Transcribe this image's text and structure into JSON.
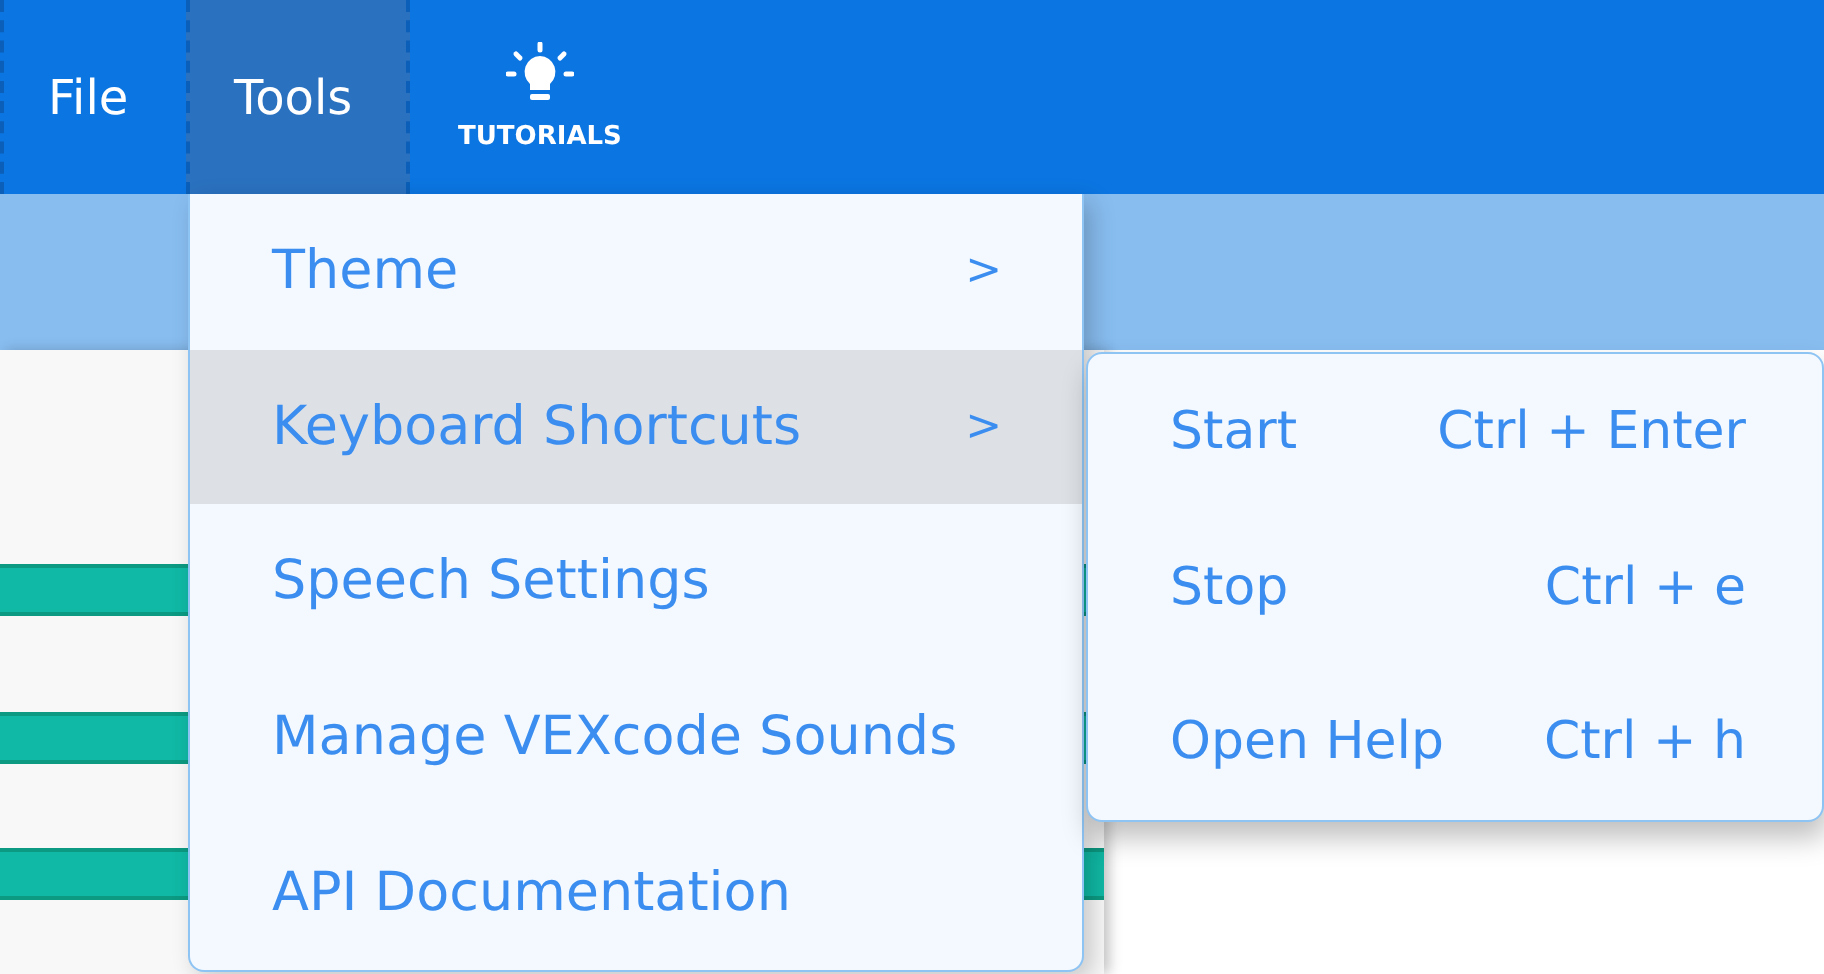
{
  "menubar": [
    {
      "kind": "text",
      "label": "File",
      "selected": false
    },
    {
      "kind": "text",
      "label": "Tools",
      "selected": true
    },
    {
      "kind": "icon",
      "label": "TUTORIALS",
      "selected": false
    }
  ],
  "tools_menu": {
    "items": [
      {
        "label": "Theme",
        "arrow": ">",
        "selected": false
      },
      {
        "label": "Keyboard Shortcuts",
        "arrow": ">",
        "selected": true
      },
      {
        "label": "Speech Settings",
        "selected": false
      },
      {
        "label": "Manage VEXcode Sounds",
        "selected": false
      },
      {
        "label": "API Documentation",
        "selected": false
      }
    ]
  },
  "shortcuts_menu": {
    "items": [
      {
        "label": "Start",
        "shortcut": "Ctrl + Enter"
      },
      {
        "label": "Stop",
        "shortcut": "Ctrl + e"
      },
      {
        "label": "Open Help",
        "shortcut": "Ctrl + h"
      }
    ]
  }
}
